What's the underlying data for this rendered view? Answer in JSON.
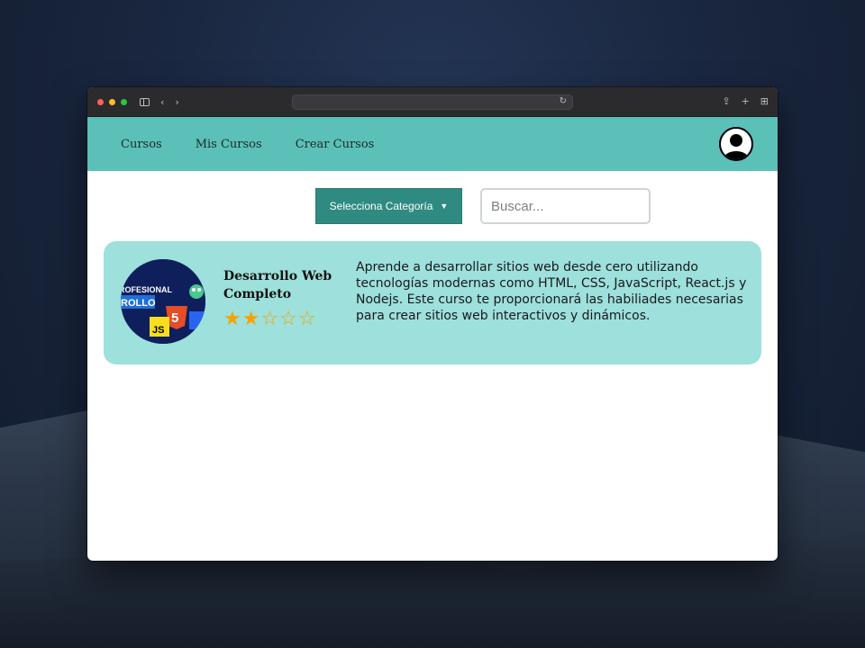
{
  "browser": {
    "address": ""
  },
  "nav": {
    "links": [
      {
        "label": "Cursos"
      },
      {
        "label": "Mis Cursos"
      },
      {
        "label": "Crear Cursos"
      }
    ]
  },
  "filters": {
    "category_label": "Selecciona Categoría",
    "search_placeholder": "Buscar..."
  },
  "course": {
    "title": "Desarrollo Web Completo",
    "rating": 2,
    "rating_max": 5,
    "stars_text": "★★☆☆☆",
    "description": "Aprende a desarrollar sitios web desde cero utilizando tecnologías modernas como HTML, CSS, JavaScript, React.js y Nodejs. Este curso te proporcionará las habiliades necesarias para crear sitios web interactivos y dinámicos.",
    "thumbnail_text": {
      "line1": "ROFESIONAL",
      "line2": "ROLLO",
      "badge": "5",
      "js": "JS"
    }
  },
  "colors": {
    "navbar": "#5bc0b8",
    "card": "#9de0dc",
    "select": "#2f8b81",
    "star": "#f5a300"
  }
}
